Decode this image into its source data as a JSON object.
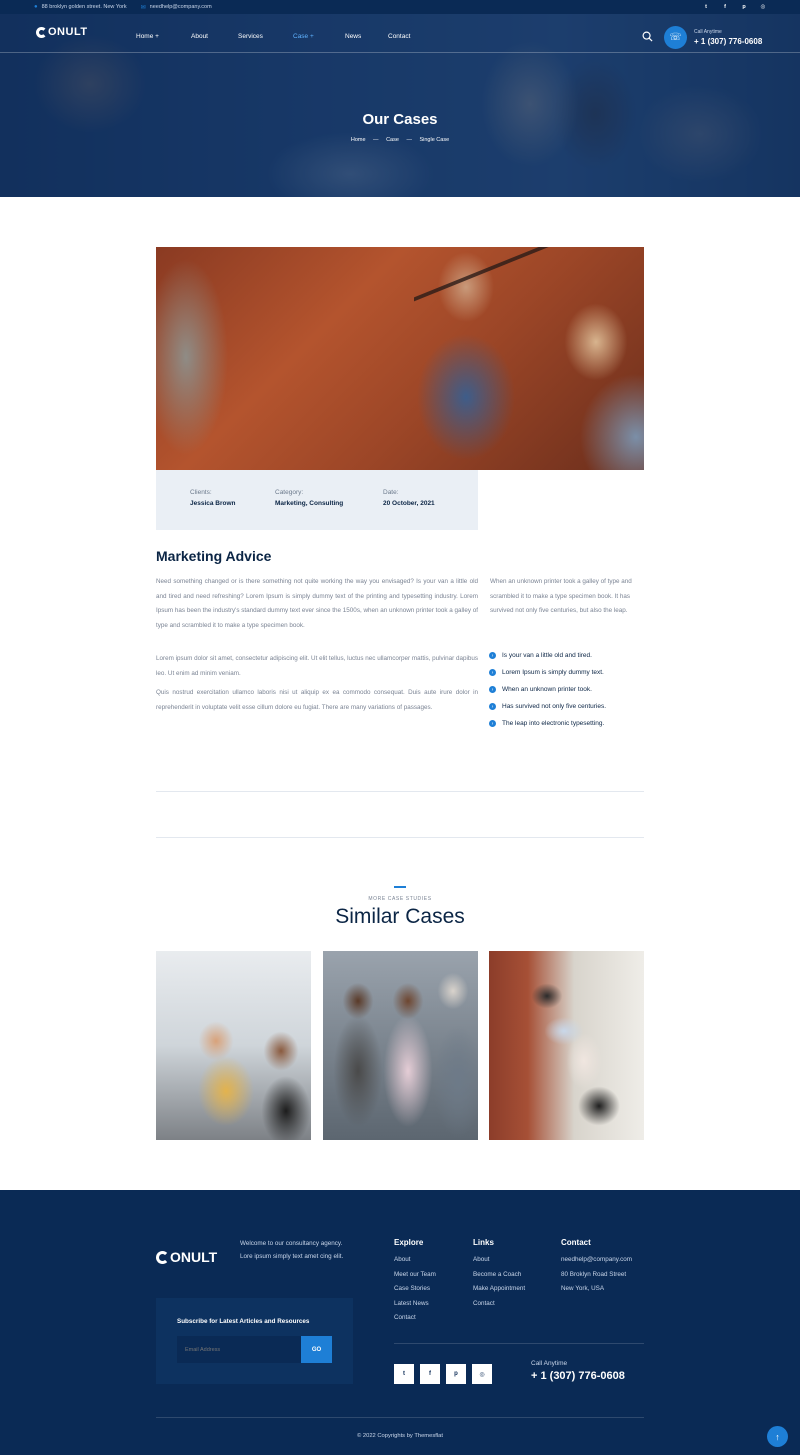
{
  "topbar": {
    "address": "88 broklyn golden street. New York",
    "email": "needhelp@company.com",
    "socials": [
      {
        "icon": "twitter-icon",
        "glyph": "t"
      },
      {
        "icon": "facebook-icon",
        "glyph": "f"
      },
      {
        "icon": "pinterest-icon",
        "glyph": "p"
      },
      {
        "icon": "instagram-icon",
        "glyph": "◎"
      }
    ]
  },
  "brand": {
    "logo_text": "ONULT"
  },
  "nav": {
    "items": [
      "Home +",
      "About",
      "Services",
      "Case +",
      "News",
      "Contact"
    ],
    "active": "Case +",
    "call_label": "Call Anytime",
    "call_number": "+ 1 (307) 776-0608"
  },
  "hero": {
    "title": "Our Cases",
    "breadcrumb": [
      "Home",
      "—",
      "Case",
      "—",
      "Single Case"
    ]
  },
  "case": {
    "meta": [
      {
        "key": "Clients:",
        "value": "Jessica Brown"
      },
      {
        "key": "Category:",
        "value": "Marketing, Consulting"
      },
      {
        "key": "Date:",
        "value": "20 October, 2021"
      }
    ],
    "title": "Marketing Advice",
    "paragraphs": [
      "Need something changed or is there something not quite working the way you envisaged? Is your van a little old and tired and need refreshing? Lorem Ipsum is simply dummy text of the printing and typesetting industry. Lorem Ipsum has been the industry's standard dummy text ever since the 1500s, when an unknown printer took a galley of type and scrambled it to make a type specimen book.",
      "Lorem ipsum dolor sit amet, consectetur adipiscing elit. Ut elit tellus, luctus nec ullamcorper mattis, pulvinar dapibus leo. Ut enim ad minim veniam.",
      "Quis nostrud exercitation ullamco laboris nisi ut aliquip ex ea commodo consequat. Duis aute irure dolor in reprehenderit in voluptate velit esse cillum dolore eu fugiat. There are many variations of passages."
    ],
    "side_paragraph": "When an unknown printer took a galley of type and scrambled it to make a type specimen book. It has survived not only five centuries, but also the leap.",
    "checklist": [
      "Is your van a little old and tired.",
      "Lorem Ipsum is simply dummy text.",
      "When an unknown printer took.",
      "Has survived not only five centuries.",
      "The leap into electronic typesetting."
    ]
  },
  "similar": {
    "kicker": "MORE CASE STUDIES",
    "title": "Similar Cases"
  },
  "footer": {
    "about": "Welcome to our consultancy agency. Lore ipsum simply text amet cing elit.",
    "explore": {
      "title": "Explore",
      "links": [
        "About",
        "Meet our Team",
        "Case Stories",
        "Latest News",
        "Contact"
      ]
    },
    "links": {
      "title": "Links",
      "links": [
        "About",
        "Become a Coach",
        "Make Appointment",
        "Contact"
      ]
    },
    "contact": {
      "title": "Contact",
      "lines": [
        "needhelp@company.com",
        "80 Broklyn Road Street",
        "New York, USA"
      ]
    },
    "subscribe": {
      "title": "Subscribe for Latest Articles and Resources",
      "placeholder": "Email Address",
      "button": "GO"
    },
    "socials": [
      {
        "icon": "twitter-icon",
        "glyph": "t"
      },
      {
        "icon": "facebook-icon",
        "glyph": "f"
      },
      {
        "icon": "pinterest-icon",
        "glyph": "p"
      },
      {
        "icon": "instagram-icon",
        "glyph": "◎"
      }
    ],
    "call_label": "Call Anytime",
    "call_number": "+ 1 (307) 776-0608",
    "copyright": "© 2022 Copyrights by Themesflat"
  },
  "colors": {
    "navy": "#0a2a55",
    "accent": "#1e7fd6",
    "text": "#0b2545",
    "muted": "#7b8494",
    "meta_bg": "#eaeff5"
  }
}
